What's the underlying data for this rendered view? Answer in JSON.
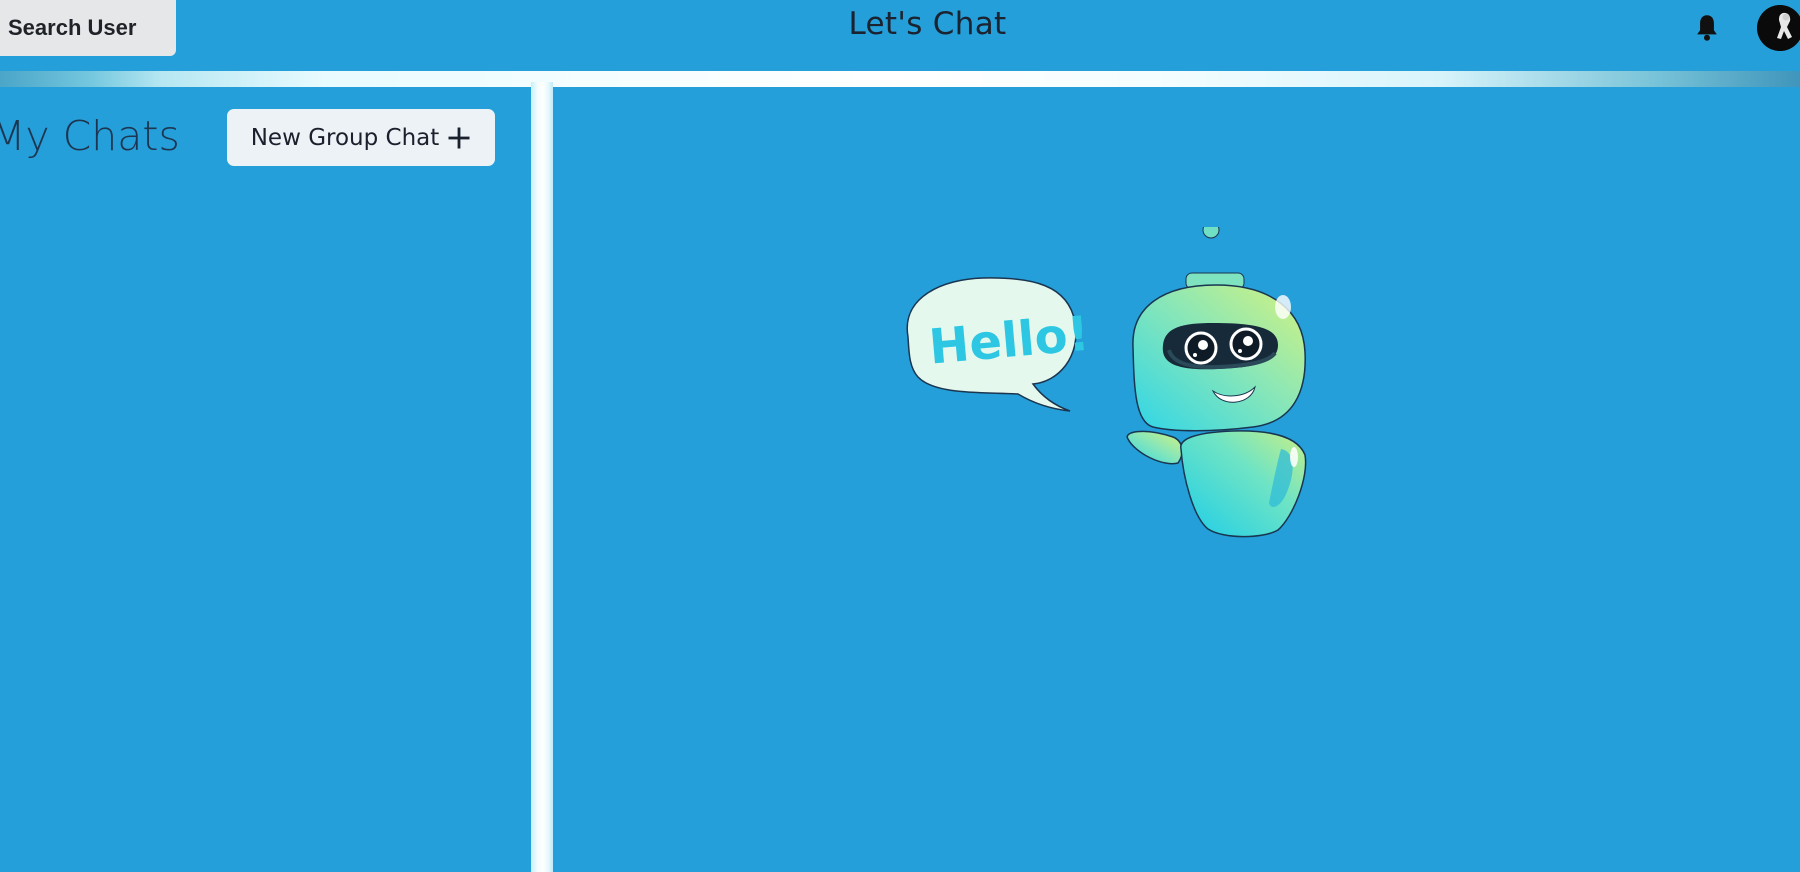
{
  "header": {
    "search_label": "Search User",
    "app_title": "Let's Chat",
    "bell_icon": "bell-icon",
    "avatar_icon": "user-avatar"
  },
  "sidebar": {
    "title": "My Chats",
    "new_group_label": "New Group Chat",
    "new_group_icon": "plus-icon"
  },
  "main": {
    "illustration_greeting": "Hello!"
  },
  "colors": {
    "background": "#249fd9",
    "button_bg": "#edf2f7",
    "title_text": "#1b2330"
  }
}
